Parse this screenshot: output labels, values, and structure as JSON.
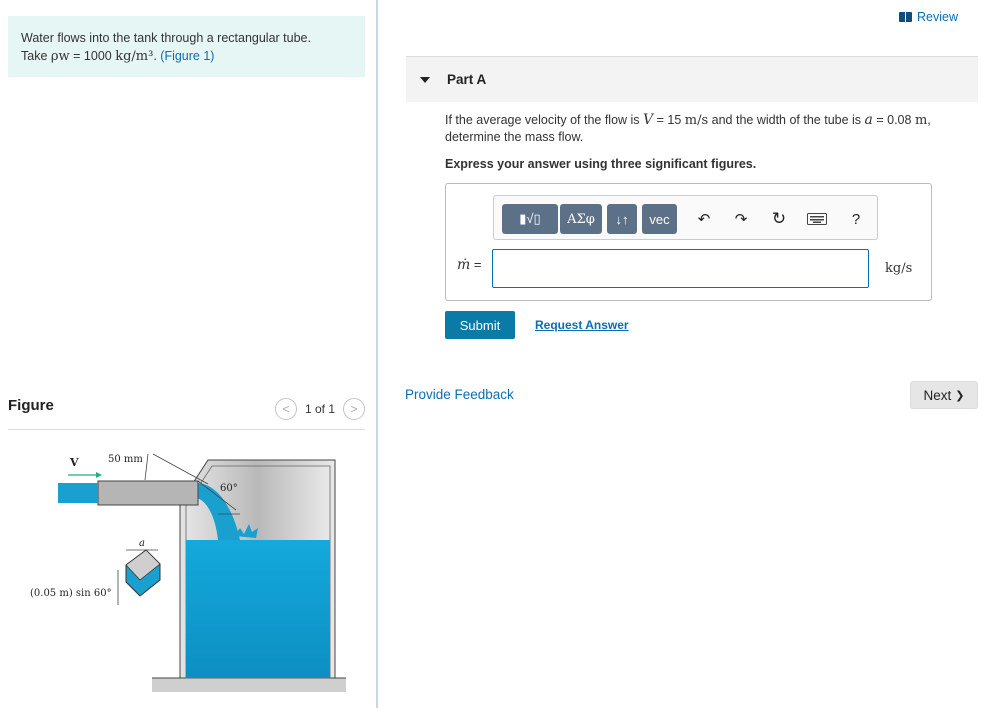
{
  "problem": {
    "line1": "Water flows into the tank through a rectangular tube.",
    "take": "Take ",
    "rho": "ρw",
    "equals": " = 1000 ",
    "unit": "kg/m³",
    "period": ". ",
    "figure_link": "(Figure 1)"
  },
  "figure": {
    "title": "Figure",
    "pager_text": "1 of 1",
    "prev_glyph": "<",
    "next_glyph": ">",
    "labels": {
      "velocity": "V",
      "dim_50mm": "50 mm",
      "angle": "60°",
      "width": "a",
      "height": "(0.05 m) sin 60°"
    },
    "colors": {
      "water": "#1aa0cf",
      "tube": "#b8b8b8",
      "arrow": "#22b07a"
    }
  },
  "review": {
    "label": "Review"
  },
  "part": {
    "title": "Part A"
  },
  "question": {
    "t1": "If the average velocity of the flow is ",
    "V": "V",
    "t2": " = 15 ",
    "u1": "m/s",
    "t3": " and the width of the tube is ",
    "a": "a",
    "t4": " = 0.08 ",
    "u2": "m",
    "t5": ",",
    "line2": "determine the mass flow.",
    "instruction": "Express your answer using three significant figures."
  },
  "toolbar": {
    "templates": "▮√▯",
    "greek": "ΑΣφ",
    "arrows": "↓↑",
    "vec": "vec",
    "help": "?"
  },
  "answer": {
    "label_symbol": "ṁ",
    "label_equals": " =",
    "value": "",
    "units": "kg/s"
  },
  "buttons": {
    "submit": "Submit",
    "request": "Request Answer",
    "feedback": "Provide Feedback",
    "next": "Next",
    "next_glyph": "❯"
  }
}
